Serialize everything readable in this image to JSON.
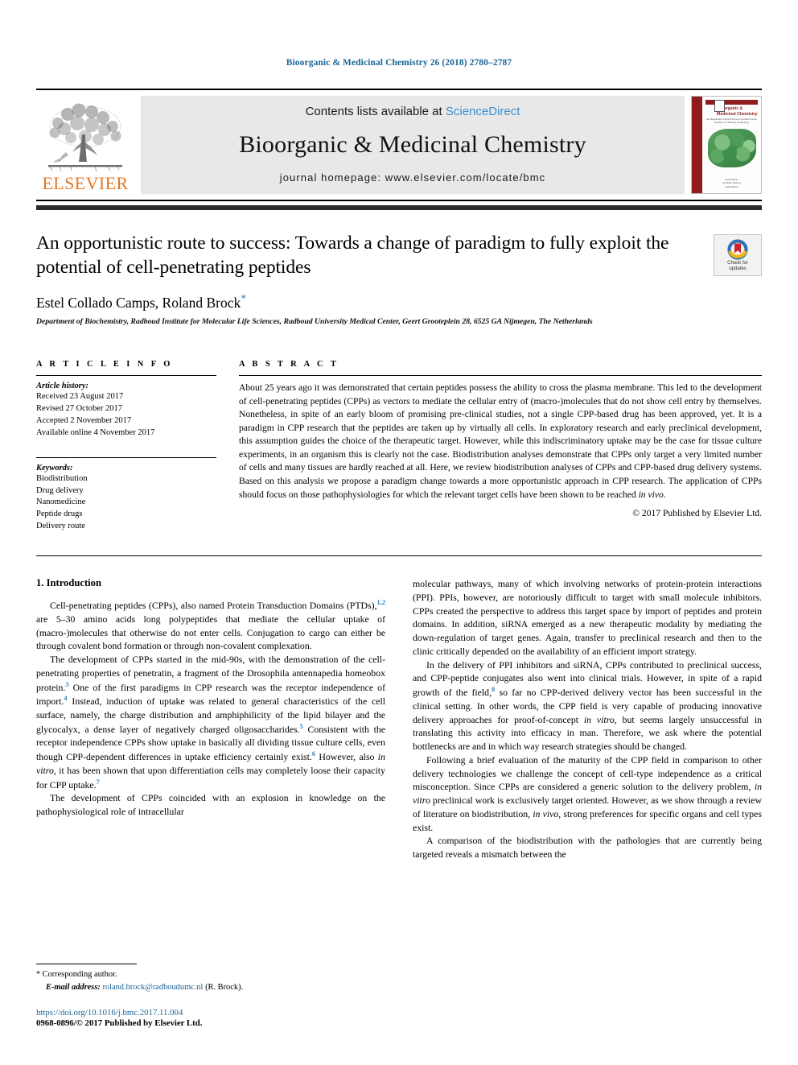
{
  "running_head": "Bioorganic & Medicinal Chemistry 26 (2018) 2780–2787",
  "masthead": {
    "publisher_name": "ELSEVIER",
    "contents_prefix": "Contents lists available at ",
    "contents_link": "ScienceDirect",
    "journal_title": "Bioorganic & Medicinal Chemistry",
    "homepage_line": "journal homepage: www.elsevier.com/locate/bmc",
    "cover": {
      "title": "Bioorganic & Medicinal Chemistry",
      "subtitle": "An International Journal Devoted to Research at the Interface of Chemistry and Biology",
      "footer_a": "Guest Editors",
      "footer_b": "Available online at",
      "footer_c": "ScienceDirect"
    }
  },
  "article": {
    "title": "An opportunistic route to success: Towards a change of paradigm to fully exploit the potential of cell-penetrating peptides",
    "authors": "Estel Collado Camps, Roland Brock",
    "corresponding_marker": "*",
    "affiliation": "Department of Biochemistry, Radboud Institute for Molecular Life Sciences, Radboud University Medical Center, Geert Grooteplein 28, 6525 GA Nijmegen, The Netherlands",
    "crossmark_label_line1": "Check for",
    "crossmark_label_line2": "updates"
  },
  "article_info": {
    "heading": "A R T I C L E   I N F O",
    "history_label": "Article history:",
    "history": [
      "Received 23 August 2017",
      "Revised 27 October 2017",
      "Accepted 2 November 2017",
      "Available online 4 November 2017"
    ],
    "keywords_label": "Keywords:",
    "keywords": [
      "Biodistribution",
      "Drug delivery",
      "Nanomedicine",
      "Peptide drugs",
      "Delivery route"
    ]
  },
  "abstract": {
    "heading": "A B S T R A C T",
    "text": "About 25 years ago it was demonstrated that certain peptides possess the ability to cross the plasma membrane. This led to the development of cell-penetrating peptides (CPPs) as vectors to mediate the cellular entry of (macro-)molecules that do not show cell entry by themselves. Nonetheless, in spite of an early bloom of promising pre-clinical studies, not a single CPP-based drug has been approved, yet. It is a paradigm in CPP research that the peptides are taken up by virtually all cells. In exploratory research and early preclinical development, this assumption guides the choice of the therapeutic target. However, while this indiscriminatory uptake may be the case for tissue culture experiments, in an organism this is clearly not the case. Biodistribution analyses demonstrate that CPPs only target a very limited number of cells and many tissues are hardly reached at all. Here, we review biodistribution analyses of CPPs and CPP-based drug delivery systems. Based on this analysis we propose a paradigm change towards a more opportunistic approach in CPP research. The application of CPPs should focus on those pathophysiologies for which the relevant target cells have been shown to be reached ",
    "text_italic_tail": "in vivo",
    "text_end": ".",
    "copyright": "© 2017 Published by Elsevier Ltd."
  },
  "body": {
    "section_title": "1. Introduction",
    "left": {
      "p1_a": "Cell-penetrating peptides (CPPs), also named Protein Transduction Domains (PTDs),",
      "p1_ref": "1,2",
      "p1_b": " are 5–30 amino acids long polypeptides that mediate the cellular uptake of (macro-)molecules that otherwise do not enter cells. Conjugation to cargo can either be through covalent bond formation or through non-covalent complexation.",
      "p2_a": "The development of CPPs started in the mid-90s, with the demonstration of the cell-penetrating properties of penetratin, a fragment of the Drosophila antennapedia homeobox protein.",
      "p2_ref1": "3",
      "p2_b": " One of the first paradigms in CPP research was the receptor independence of import.",
      "p2_ref2": "4",
      "p2_c": " Instead, induction of uptake was related to general characteristics of the cell surface, namely, the charge distribution and amphiphilicity of the lipid bilayer and the glycocalyx, a dense layer of negatively charged oligosaccharides.",
      "p2_ref3": "5",
      "p2_d": " Consistent with the receptor independence CPPs show uptake in basically all dividing tissue culture cells, even though CPP-dependent differences in uptake efficiency certainly exist.",
      "p2_ref4": "6",
      "p2_e": " However, also ",
      "p2_it": "in vitro",
      "p2_f": ", it has been shown that upon differentiation cells may completely loose their capacity for CPP uptake.",
      "p2_ref5": "7",
      "p3": "The development of CPPs coincided with an explosion in knowledge on the pathophysiological role of intracellular"
    },
    "right": {
      "p1": "molecular pathways, many of which involving networks of protein-protein interactions (PPI). PPIs, however, are notoriously difficult to target with small molecule inhibitors. CPPs created the perspective to address this target space by import of peptides and protein domains. In addition, siRNA emerged as a new therapeutic modality by mediating the down-regulation of target genes. Again, transfer to preclinical research and then to the clinic critically depended on the availability of an efficient import strategy.",
      "p2_a": "In the delivery of PPI inhibitors and siRNA, CPPs contributed to preclinical success, and CPP-peptide conjugates also went into clinical trials. However, in spite of a rapid growth of the field,",
      "p2_ref": "8",
      "p2_b": " so far no CPP-derived delivery vector has been successful in the clinical setting. In other words, the CPP field is very capable of producing innovative delivery approaches for proof-of-concept ",
      "p2_it": "in vitro",
      "p2_c": ", but seems largely unsuccessful in translating this activity into efficacy in man. Therefore, we ask where the potential bottlenecks are and in which way research strategies should be changed.",
      "p3_a": "Following a brief evaluation of the maturity of the CPP field in comparison to other delivery technologies we challenge the concept of cell-type independence as a critical misconception. Since CPPs are considered a generic solution to the delivery problem, ",
      "p3_it1": "in vitro",
      "p3_b": " preclinical work is exclusively target oriented. However, as we show through a review of literature on biodistribution, ",
      "p3_it2": "in vivo",
      "p3_c": ", strong preferences for specific organs and cell types exist.",
      "p4": "A comparison of the biodistribution with the pathologies that are currently being targeted reveals a mismatch between the"
    }
  },
  "footnote": {
    "corresponding_star": "*",
    "corresponding_text": " Corresponding author.",
    "email_label": "E-mail address:",
    "email": "roland.brock@radboudumc.nl",
    "email_owner": "(R. Brock).",
    "doi": "https://doi.org/10.1016/j.bmc.2017.11.004",
    "issn_copyright": "0968-0896/© 2017 Published by Elsevier Ltd."
  },
  "colors": {
    "link_blue": "#1a6496",
    "sciencedirect_blue": "#3a8fd0",
    "reference_blue": "#2a7fb8",
    "elsevier_orange": "#e87722",
    "cover_red": "#8f1d1d"
  }
}
